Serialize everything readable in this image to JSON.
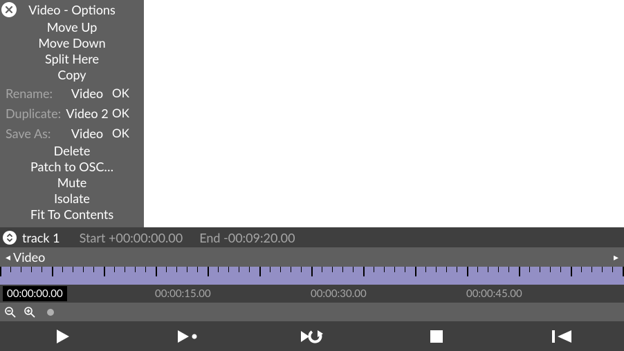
{
  "options": {
    "title": "Video - Options",
    "items_above": [
      "Move Up",
      "Move Down",
      "Split Here",
      "Copy"
    ],
    "rename_label": "Rename:",
    "rename_value": "Video",
    "rename_ok": "OK",
    "duplicate_label": "Duplicate:",
    "duplicate_value": "Video 2",
    "duplicate_ok": "OK",
    "saveas_label": "Save As:",
    "saveas_value": "Video",
    "saveas_ok": "OK",
    "items_below": [
      "Delete",
      "Patch to OSC…",
      "Mute",
      "Isolate",
      "Fit To Contents"
    ]
  },
  "track": {
    "name": "track 1",
    "start": "Start +00:00:00.00",
    "end": "End -00:09:20.00"
  },
  "layer": {
    "name": "Video"
  },
  "timeline": {
    "playhead": "00:00:00.00",
    "labels": [
      "00:00:15.00",
      "00:00:30.00",
      "00:00:45.00"
    ]
  }
}
